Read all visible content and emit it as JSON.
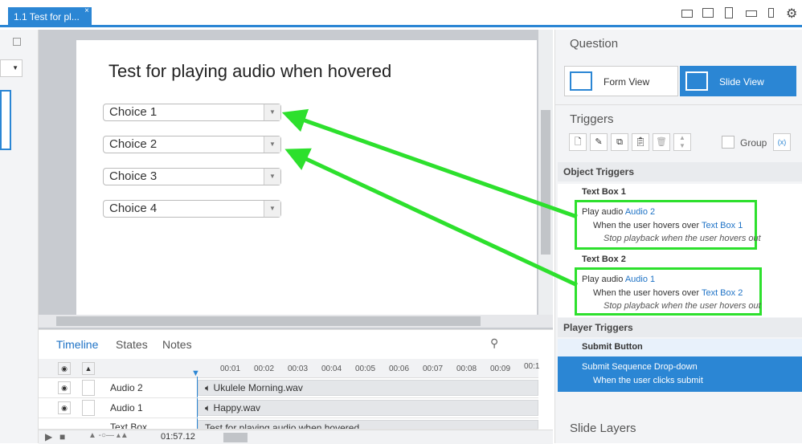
{
  "tab": {
    "title": "1.1 Test for pl...",
    "close": "×"
  },
  "slide": {
    "title": "Test for playing audio when hovered",
    "choices": [
      "Choice 1",
      "Choice 2",
      "Choice 3",
      "Choice 4"
    ]
  },
  "timeline": {
    "tabs": [
      "Timeline",
      "States",
      "Notes"
    ],
    "ticks": [
      "00:01",
      "00:02",
      "00:03",
      "00:04",
      "00:05",
      "00:06",
      "00:07",
      "00:08",
      "00:09",
      "00:1"
    ],
    "rows": [
      {
        "name": "Audio 2",
        "bar": "Ukulele Morning.wav"
      },
      {
        "name": "Audio 1",
        "bar": "Happy.wav"
      },
      {
        "name": "Text Box",
        "bar": "Test for playing audio when hovered"
      }
    ],
    "time": "01:57.12"
  },
  "question": {
    "title": "Question",
    "form_view": "Form View",
    "slide_view": "Slide View"
  },
  "triggers": {
    "title": "Triggers",
    "group": "Group",
    "object_triggers": "Object Triggers",
    "player_triggers": "Player Triggers",
    "items": [
      {
        "object": "Text Box 1",
        "action": "Play audio",
        "target": "Audio 2",
        "when": "When the",
        "who": "user hovers over",
        "obj": "Text Box 1",
        "stop": "Stop playback when the user hovers out"
      },
      {
        "object": "Text Box 2",
        "action": "Play audio",
        "target": "Audio 1",
        "when": "When the",
        "who": "user hovers over",
        "obj": "Text Box 2",
        "stop": "Stop playback when the user hovers out"
      }
    ],
    "submit": {
      "name": "Submit Button",
      "action": "Submit Sequence Drop-down",
      "when": "When the user clicks submit"
    }
  },
  "slide_layers": "Slide Layers",
  "colors": {
    "accent": "#2b86d4",
    "highlight": "#2de02d"
  }
}
